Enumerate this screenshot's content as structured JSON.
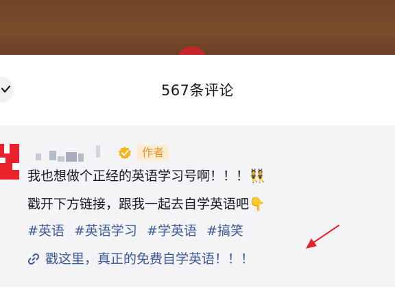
{
  "header": {
    "title": "567条评论"
  },
  "comment": {
    "author_tag": "作者",
    "line1": "我也想做个正经的英语学习号啊！！！",
    "line1_emoji": "👯",
    "line2": "戳开下方链接，跟我一起去自学英语吧",
    "line2_emoji": "👇",
    "hashtags": [
      "#英语",
      "#英语学习",
      "#学英语",
      "#搞笑"
    ],
    "link_text": "戳这里，真正的免费自学英语！！！"
  },
  "colors": {
    "accent_link": "#3c5a99",
    "author_tag_bg": "#fdeccf",
    "author_tag_text": "#e2922c",
    "verified_badge": "#f5b51d",
    "annotation_arrow": "#e3242b"
  },
  "icons": {
    "collapse": "chevron-down-icon",
    "verified": "verified-badge-icon",
    "link": "link-icon"
  }
}
